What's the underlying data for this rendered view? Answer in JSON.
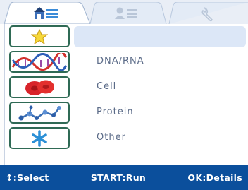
{
  "tabs": [
    {
      "icon": "home-list-icon",
      "active": true
    },
    {
      "icon": "user-list-icon",
      "active": false
    },
    {
      "icon": "wrench-icon",
      "active": false
    }
  ],
  "menu": {
    "items": [
      {
        "icon": "star-icon",
        "label": "",
        "selected": true
      },
      {
        "icon": "dna-helix-icon",
        "label": "DNA/RNA",
        "selected": false
      },
      {
        "icon": "red-cells-icon",
        "label": "Cell",
        "selected": false
      },
      {
        "icon": "protein-molecule-icon",
        "label": "Protein",
        "selected": false
      },
      {
        "icon": "asterisk-icon",
        "label": "Other",
        "selected": false
      }
    ]
  },
  "statusbar": {
    "select": "↕:Select",
    "run": "START:Run",
    "details": "OK:Details"
  },
  "colors": {
    "statusbar_bg": "#0b4f9c",
    "thumb_border": "#2f6a55",
    "selection": "#dce7f7",
    "label_text": "#5b6b88"
  }
}
